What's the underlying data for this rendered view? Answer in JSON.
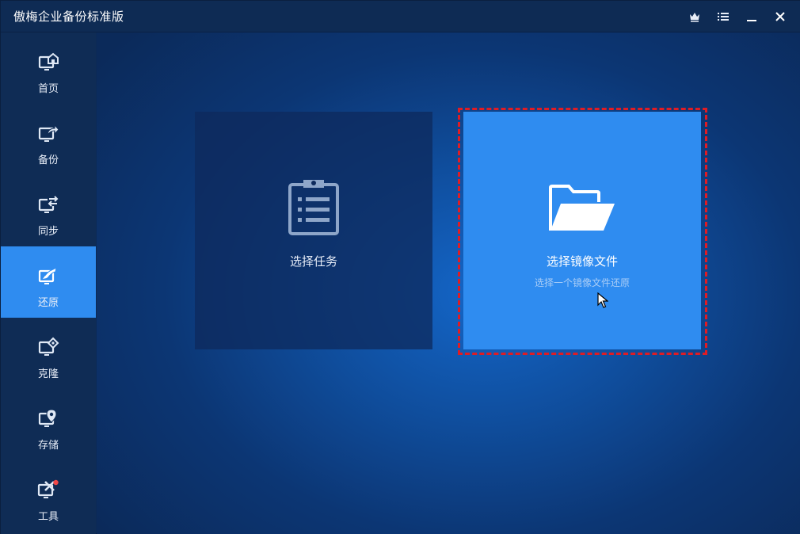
{
  "app": {
    "title": "傲梅企业备份标准版"
  },
  "window_controls": [
    {
      "name": "upgrade",
      "icon": "crown-icon"
    },
    {
      "name": "menu",
      "icon": "menu-icon"
    },
    {
      "name": "minimize",
      "icon": "minimize-icon"
    },
    {
      "name": "close",
      "icon": "close-icon"
    }
  ],
  "sidebar": {
    "items": [
      {
        "label": "首页",
        "icon": "home-monitor-icon",
        "active": false
      },
      {
        "label": "备份",
        "icon": "backup-monitor-icon",
        "active": false
      },
      {
        "label": "同步",
        "icon": "sync-monitor-icon",
        "active": false
      },
      {
        "label": "还原",
        "icon": "restore-monitor-icon",
        "active": true
      },
      {
        "label": "克隆",
        "icon": "clone-monitor-icon",
        "active": false
      },
      {
        "label": "存储",
        "icon": "storage-monitor-icon",
        "active": false
      },
      {
        "label": "工具",
        "icon": "tools-monitor-icon",
        "active": false,
        "badge": true
      }
    ]
  },
  "cards": {
    "task": {
      "title": "选择任务",
      "icon": "clipboard-icon"
    },
    "image": {
      "title": "选择镜像文件",
      "subtitle": "选择一个镜像文件还原",
      "icon": "folder-open-icon"
    }
  },
  "colors": {
    "accent": "#2f8cf0",
    "sidebar_bg": "#0f2c55",
    "highlight_outline": "#e01c24",
    "badge": "#f04848"
  }
}
